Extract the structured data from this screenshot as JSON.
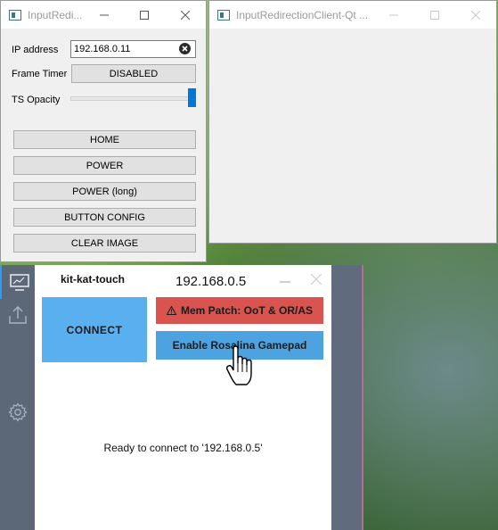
{
  "main_window": {
    "title": "InputRedi...",
    "ip_label": "IP address",
    "ip_value": "192.168.0.11",
    "frame_timer_label": "Frame Timer",
    "frame_timer_value": "DISABLED",
    "ts_opacity_label": "TS Opacity",
    "ts_opacity_value": 1.0,
    "buttons": [
      "HOME",
      "POWER",
      "POWER (long)",
      "BUTTON CONFIG",
      "CLEAR IMAGE"
    ]
  },
  "qt_window": {
    "title": "InputRedirectionClient-Qt ..."
  },
  "kkt_window": {
    "app_name": "kit-kat-touch",
    "ip": "192.168.0.5",
    "connect_label": "CONNECT",
    "mem_patch_label": "Mem Patch: OoT & OR/AS",
    "rosalina_label": "Enable Rosalina Gamepad",
    "status": "Ready to connect to '192.168.0.5'",
    "colors": {
      "connect_bg": "#5aafef",
      "mem_patch_bg": "#d9534f",
      "rosalina_bg": "#4da3e0",
      "sidebar_bg": "#5c6878"
    }
  },
  "icons": [
    "app-icon",
    "minimize-icon",
    "maximize-icon",
    "close-icon",
    "clear-input-icon",
    "monitor-icon",
    "upload-icon",
    "gear-icon",
    "warning-icon",
    "hand-cursor-icon"
  ]
}
